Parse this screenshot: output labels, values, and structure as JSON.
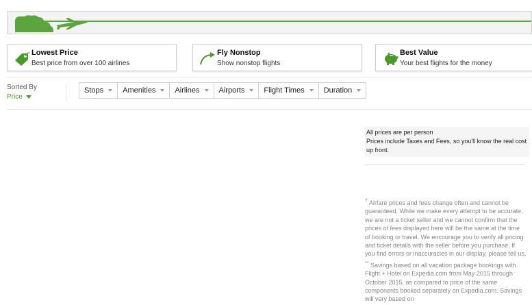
{
  "progress": {
    "fraction": 1.0,
    "color": "#5aa63c"
  },
  "features": [
    {
      "icon": "price-tag-icon",
      "title": "Lowest Price",
      "desc": "Best price from over 100 airlines"
    },
    {
      "icon": "nonstop-arrow-icon",
      "title": "Fly Nonstop",
      "desc": "Show nonstop flights"
    },
    {
      "icon": "piggy-bank-icon",
      "title": "Best Value",
      "desc": "Your best flights for the money"
    }
  ],
  "sort": {
    "label": "Sorted By",
    "value": "Price"
  },
  "filters": [
    "Stops",
    "Amenities",
    "Airlines",
    "Airports",
    "Flight Times",
    "Duration"
  ],
  "price_note": {
    "line1": "All prices are per person",
    "line2": "Prices include Taxes and Fees, so you'll know the real cost up front."
  },
  "disclaimers": {
    "d1_mark": "†",
    "d1": "Airfare prices and fees change often and cannot be guaranteed. While we make every attempt to be accurate, we are not a ticket seller and we cannot confirm that the prices of fees displayed here will be the same at the time of booking or travel. We encourage you to verify all pricing and ticket details with the seller before you purchase. If you find errors or inaccuracies in our display, please tell us.",
    "d2_mark": "**",
    "d2": "Savings based on all vacation package bookings with Flight + Hotel on Expedia.com from May 2015 through October 2015, as compared to price of the same components booked separately on Expedia.com. Savings will vary based on"
  },
  "colors": {
    "accent": "#5aa63c",
    "border": "#cfcfcf"
  }
}
